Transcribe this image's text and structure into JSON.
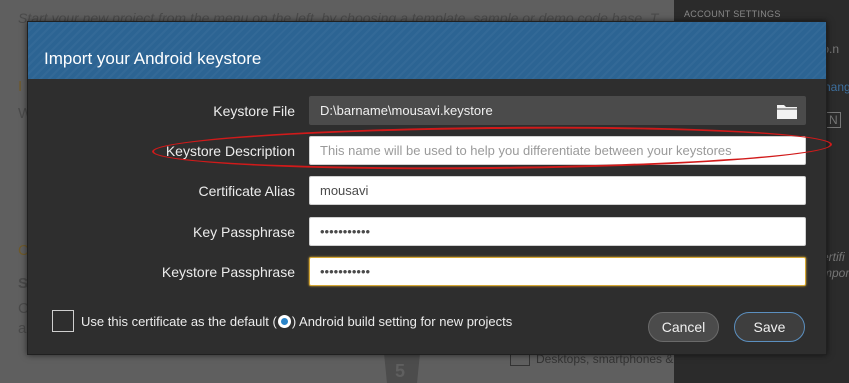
{
  "background": {
    "intro_text": "Start your new project from the menu on the left, by choosing a template, sample or demo code base. T",
    "fragments": {
      "letter_w": "W",
      "letter_i": "I",
      "letter_c": "C",
      "letter_s": "S",
      "letter_c2": "C",
      "letter_a": "a"
    },
    "desktops_text": "Desktops, smartphones &",
    "html5_label": "5",
    "sidebar": {
      "title": "ACCOUNT SETTINGS",
      "frag_info": "fo.n",
      "frag_mang": "nang",
      "frag_n": "N",
      "frag_ertif": "ertifi",
      "frag_mpor": "mpor"
    }
  },
  "dialog": {
    "title": "Import your Android keystore",
    "fields": {
      "keystore_file": {
        "label": "Keystore File",
        "value": "D:\\barname\\mousavi.keystore"
      },
      "keystore_description": {
        "label": "Keystore Description",
        "value": "",
        "placeholder": "This name will be used to help you differentiate between your keystores"
      },
      "certificate_alias": {
        "label": "Certificate Alias",
        "value": "mousavi"
      },
      "key_passphrase": {
        "label": "Key Passphrase",
        "value": "•••••••••••"
      },
      "keystore_passphrase": {
        "label": "Keystore Passphrase",
        "value": "•••••••••••"
      }
    },
    "default_checkbox": {
      "checked": false,
      "label_before": "Use this certificate as the default (",
      "label_after": ") Android build setting for new projects"
    },
    "buttons": {
      "cancel": "Cancel",
      "save": "Save"
    }
  },
  "icons": {
    "folder": "folder-icon",
    "help": "help-circle-icon",
    "html5": "html5-logo-icon",
    "devices": "devices-icon"
  },
  "colors": {
    "header_blue": "#2c6493",
    "dialog_bg": "#2e2e2e",
    "focus_border": "#d7a935",
    "annotation_red": "#d11a1a",
    "save_border": "#5b8fbf"
  }
}
